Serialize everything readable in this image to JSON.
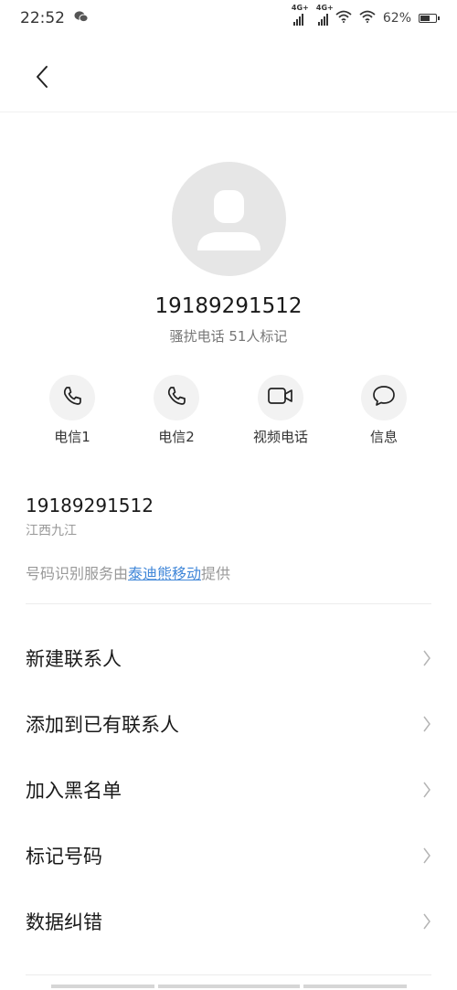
{
  "status_bar": {
    "time": "22:52",
    "network_1": "4G+",
    "network_2": "4G+",
    "battery_percent": "62%",
    "battery_level": 0.62,
    "icons": [
      "wechat-icon",
      "signal-icon",
      "signal-icon",
      "wifi-icon",
      "wifi-icon",
      "battery-icon"
    ]
  },
  "header": {
    "back_icon": "chevron-left-icon"
  },
  "contact": {
    "avatar_icon": "person-icon",
    "number": "19189291512",
    "tag": "骚扰电话 51人标记"
  },
  "actions": [
    {
      "label": "电信1",
      "icon": "phone-icon"
    },
    {
      "label": "电信2",
      "icon": "phone-icon"
    },
    {
      "label": "视频电话",
      "icon": "video-camera-icon"
    },
    {
      "label": "信息",
      "icon": "message-icon"
    }
  ],
  "info": {
    "number": "19189291512",
    "location": "江西九江",
    "provider_prefix": "号码识别服务由",
    "provider_link": "泰迪熊移动",
    "provider_suffix": "提供"
  },
  "menu": [
    {
      "label": "新建联系人",
      "icon": "chevron-right-icon"
    },
    {
      "label": "添加到已有联系人",
      "icon": "chevron-right-icon"
    },
    {
      "label": "加入黑名单",
      "icon": "chevron-right-icon"
    },
    {
      "label": "标记号码",
      "icon": "chevron-right-icon"
    },
    {
      "label": "数据纠错",
      "icon": "chevron-right-icon"
    }
  ],
  "colors": {
    "accent_link": "#3f86d8",
    "avatar_bg": "#e6e6e6",
    "action_bg": "#f2f2f2"
  }
}
